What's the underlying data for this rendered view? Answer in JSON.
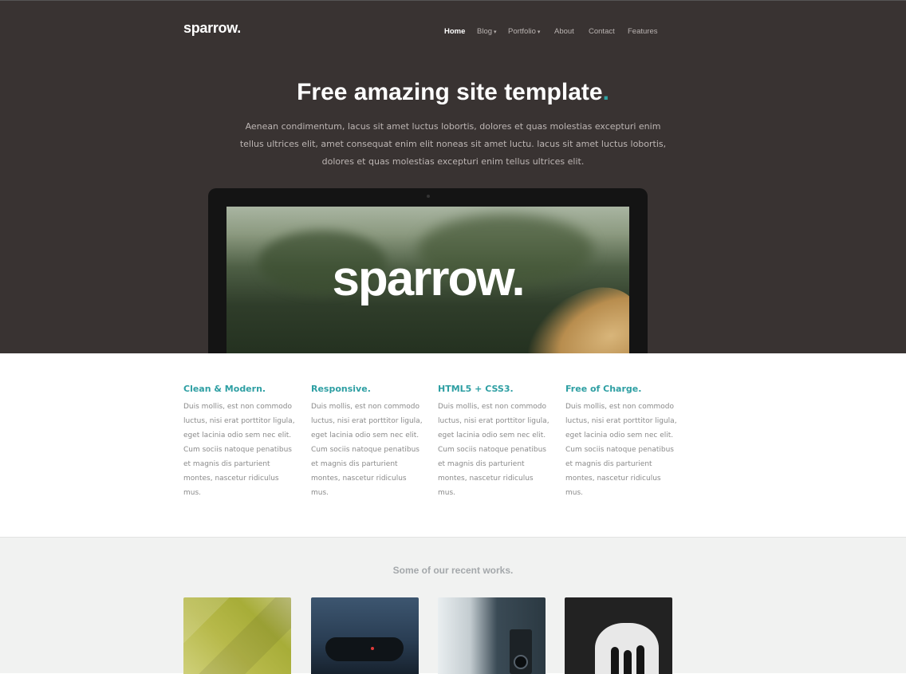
{
  "site": {
    "logo": "sparrow."
  },
  "nav": {
    "items": [
      {
        "label": "Home",
        "active": true,
        "has_dropdown": false
      },
      {
        "label": "Blog",
        "active": false,
        "has_dropdown": true
      },
      {
        "label": "Portfolio",
        "active": false,
        "has_dropdown": true
      },
      {
        "label": "About",
        "active": false,
        "has_dropdown": false
      },
      {
        "label": "Contact",
        "active": false,
        "has_dropdown": false
      },
      {
        "label": "Features",
        "active": false,
        "has_dropdown": false
      }
    ]
  },
  "hero": {
    "title": "Free amazing site template",
    "title_dot": ".",
    "description": "Aenean condimentum, lacus sit amet luctus lobortis, dolores et quas molestias excepturi enim tellus ultrices elit, amet consequat enim elit noneas sit amet luctu. lacus sit amet luctus lobortis, dolores et quas molestias excepturi enim tellus ultrices elit.",
    "screen_logo": "sparrow."
  },
  "features": [
    {
      "title": "Clean & Modern.",
      "text": "Duis mollis, est non commodo luctus, nisi erat porttitor ligula, eget lacinia odio sem nec elit. Cum sociis natoque penatibus et magnis dis parturient montes, nascetur ridiculus mus."
    },
    {
      "title": "Responsive.",
      "text": "Duis mollis, est non commodo luctus, nisi erat porttitor ligula, eget lacinia odio sem nec elit. Cum sociis natoque penatibus et magnis dis parturient montes, nascetur ridiculus mus."
    },
    {
      "title": "HTML5 + CSS3.",
      "text": "Duis mollis, est non commodo luctus, nisi erat porttitor ligula, eget lacinia odio sem nec elit. Cum sociis natoque penatibus et magnis dis parturient montes, nascetur ridiculus mus."
    },
    {
      "title": "Free of Charge.",
      "text": "Duis mollis, est non commodo luctus, nisi erat porttitor ligula, eget lacinia odio sem nec elit. Cum sociis natoque penatibus et magnis dis parturient montes, nascetur ridiculus mus."
    }
  ],
  "works": {
    "title": "Some of our recent works."
  },
  "colors": {
    "hero_bg": "#393332",
    "accent": "#2e9fa3",
    "works_bg": "#f1f2f1"
  }
}
